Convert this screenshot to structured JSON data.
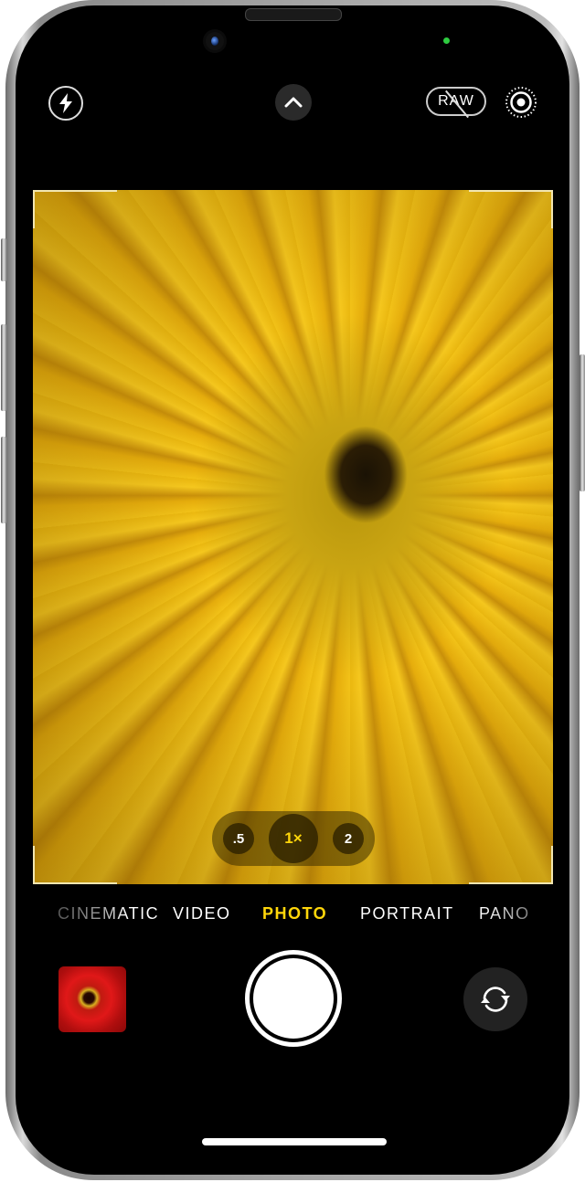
{
  "app": "Camera",
  "top_bar": {
    "flash_icon": "bolt-icon",
    "expand_controls_icon": "chevron-up-icon",
    "raw_label": "RAW",
    "raw_state": "off",
    "live_photo_icon": "live-photo-icon"
  },
  "indicators": {
    "privacy_dot_color": "#2ecc40"
  },
  "viewfinder": {
    "subject": "Yellow gerbera daisy close-up"
  },
  "zoom_selector": {
    "options": [
      {
        "label": ".5",
        "active": false
      },
      {
        "label": "1×",
        "active": true
      },
      {
        "label": "2",
        "active": false
      }
    ]
  },
  "modes": {
    "items": [
      {
        "label": "CINEMATIC",
        "active": false
      },
      {
        "label": "VIDEO",
        "active": false
      },
      {
        "label": "PHOTO",
        "active": true
      },
      {
        "label": "PORTRAIT",
        "active": false
      },
      {
        "label": "PANO",
        "active": false
      }
    ],
    "active_color": "#ffd60a"
  },
  "bottom_bar": {
    "thumbnail_subject": "Red gerbera daisy photo",
    "shutter_icon": "shutter-button",
    "flip_icon": "camera-flip-icon"
  }
}
